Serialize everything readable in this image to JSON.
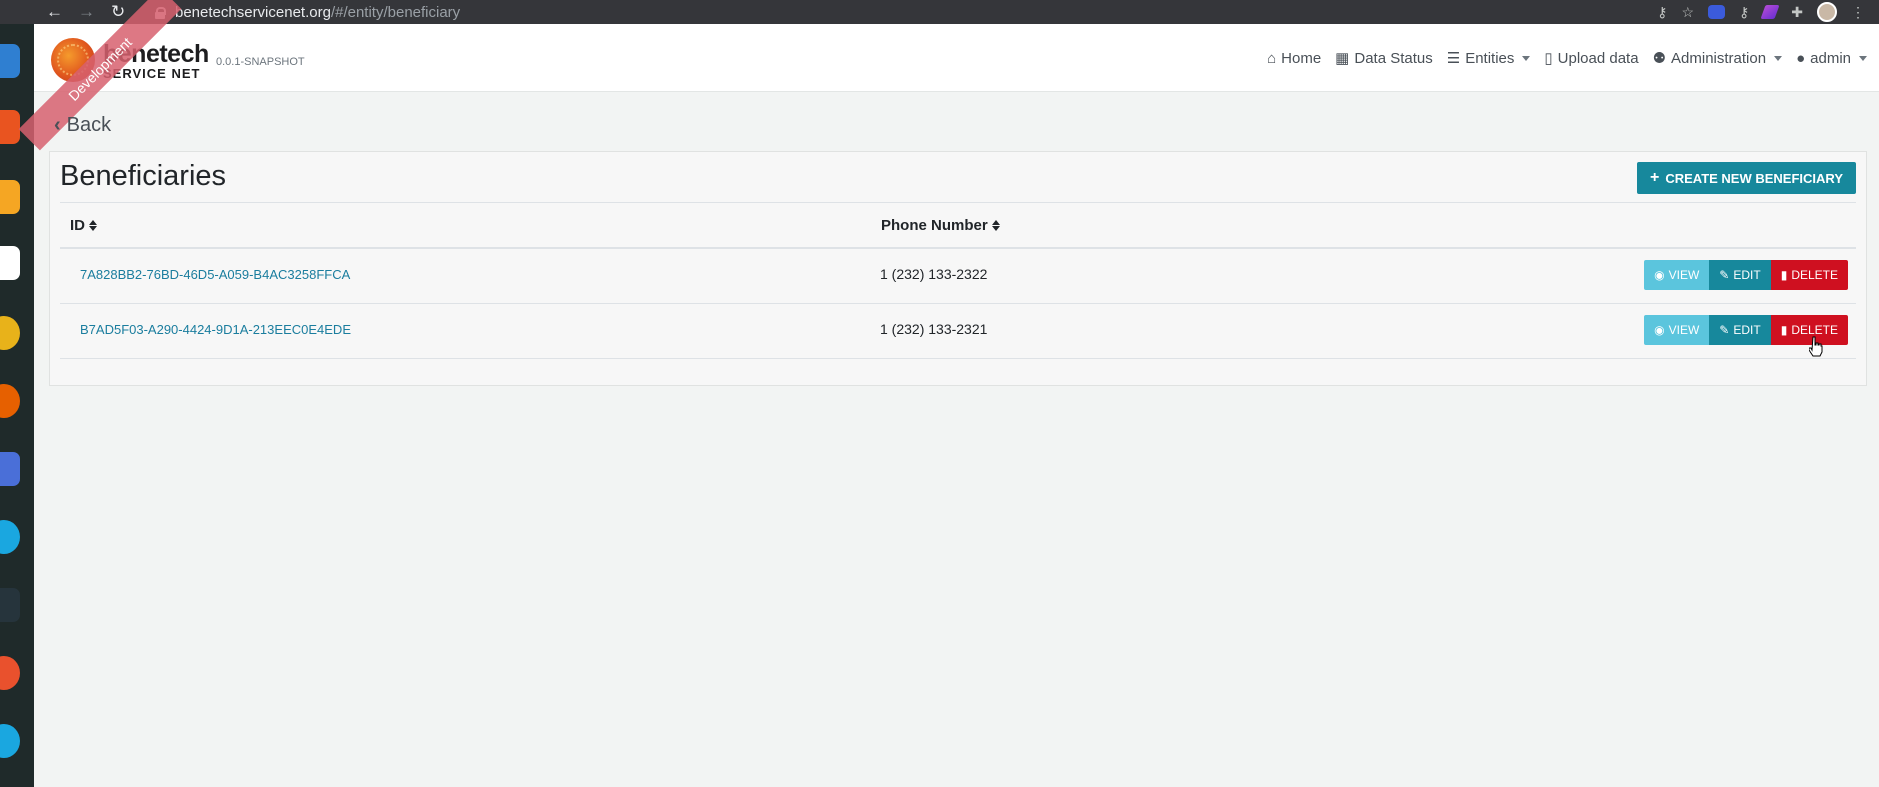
{
  "browser": {
    "back_glyph": "←",
    "forward_glyph": "→",
    "reload_glyph": "↻",
    "url_host": "benetechservicenet.org",
    "url_path": "/#/entity/beneficiary",
    "key_glyph": "⚷",
    "star_glyph": "☆",
    "puzzle_glyph": "✚",
    "menu_glyph": "⋮"
  },
  "brand": {
    "name_line1": "benetech",
    "name_line2": "SERVICE NET",
    "version": "0.0.1-SNAPSHOT",
    "ribbon": "Development"
  },
  "nav": {
    "home": "Home",
    "data_status": "Data Status",
    "entities": "Entities",
    "upload": "Upload data",
    "administration": "Administration",
    "account": "admin",
    "home_icon": "⌂",
    "table_icon": "▦",
    "list_icon": "☰",
    "file_icon": "▯",
    "user_add_icon": "⚉",
    "user_icon": "●"
  },
  "back": {
    "label": "Back",
    "icon": "‹"
  },
  "page": {
    "title": "Beneficiaries",
    "create_label": "CREATE NEW BENEFICIARY",
    "plus_icon": "+"
  },
  "table": {
    "headers": [
      "ID",
      "Phone Number"
    ],
    "rows": [
      {
        "id": "7A828BB2-76BD-46D5-A059-B4AC3258FFCA",
        "phone": "1 (232) 133-2322"
      },
      {
        "id": "B7AD5F03-A290-4424-9D1A-213EEC0E4EDE",
        "phone": "1 (232) 133-2321"
      }
    ],
    "view_label": "VIEW",
    "edit_label": "EDIT",
    "delete_label": "DELETE",
    "view_icon": "◉",
    "edit_icon": "✎",
    "delete_icon": "▮"
  },
  "colors": {
    "accent": "#17889c",
    "info": "#5bc5dd",
    "danger": "#cf1020",
    "link": "#1a7d9e"
  }
}
